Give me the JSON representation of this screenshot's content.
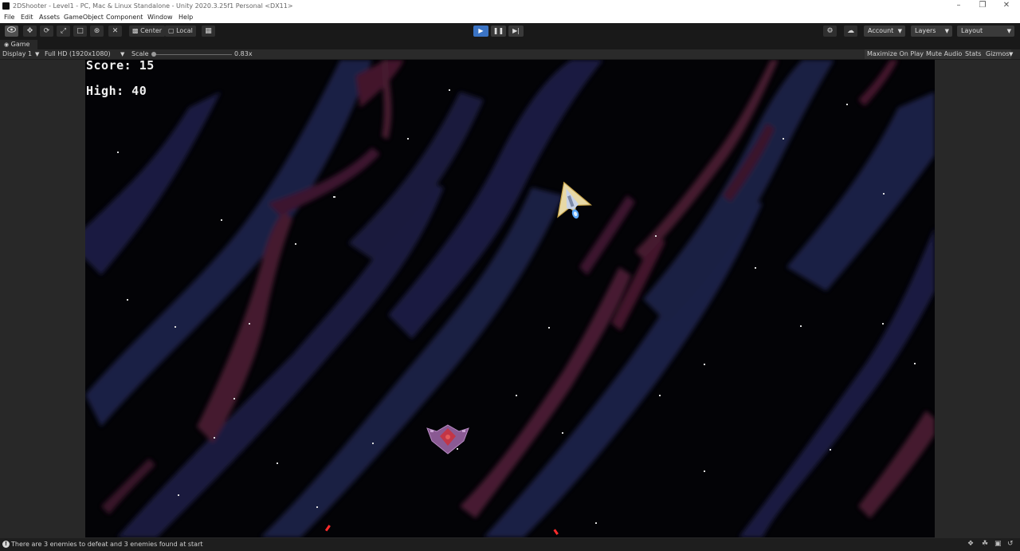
{
  "window": {
    "title": "2DShooter - Level1 - PC, Mac & Linux Standalone - Unity 2020.3.25f1 Personal <DX11>"
  },
  "menu": [
    "File",
    "Edit",
    "Assets",
    "GameObject",
    "Component",
    "Window",
    "Help"
  ],
  "toolbar": {
    "pivot_label": "Center",
    "space_label": "Local",
    "account_label": "Account",
    "layers_label": "Layers",
    "layout_label": "Layout"
  },
  "game_view": {
    "tab_label": "Game",
    "display": "Display 1",
    "resolution": "Full HD (1920x1080)",
    "scale_label": "Scale",
    "scale_value": "0.83x",
    "maximize_on_play": "Maximize On Play",
    "mute_audio": "Mute Audio",
    "stats": "Stats",
    "gizmos": "Gizmos"
  },
  "hud": {
    "score": "Score: 15",
    "high": "High: 40"
  },
  "status": {
    "message": "There are 3 enemies to defeat and 3 enemies found at start"
  },
  "colors": {
    "play_active": "#3a73c4",
    "space_bg": "#030306",
    "nebula_blue": "#1c1f45",
    "nebula_red": "#4a1a33"
  }
}
